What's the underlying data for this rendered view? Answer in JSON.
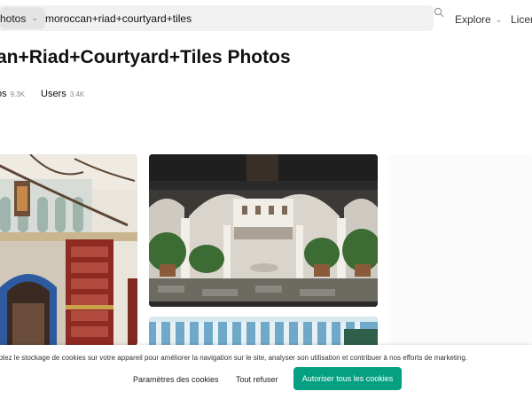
{
  "header": {
    "search_type": "hotos",
    "search_query": "moroccan+riad+courtyard+tiles",
    "nav_explore": "Explore",
    "nav_license": "Licens"
  },
  "page": {
    "title": "an+Riad+Courtyard+Tiles Photos"
  },
  "tabs": [
    {
      "label": "os",
      "count": "9.3K"
    },
    {
      "label": "Users",
      "count": "3.4K"
    }
  ],
  "cookie": {
    "text": "eptez le stockage de cookies sur votre appareil pour améliorer la navigation sur le site, analyser son utilisation et contribuer à nos efforts de marketing.",
    "settings_label": "Paramètres des cookies",
    "refuse_label": "Tout refuser",
    "accept_label": "Autoriser tous les cookies"
  },
  "colors": {
    "accept_button": "#05a081",
    "search_bg": "#f1f1f1"
  }
}
